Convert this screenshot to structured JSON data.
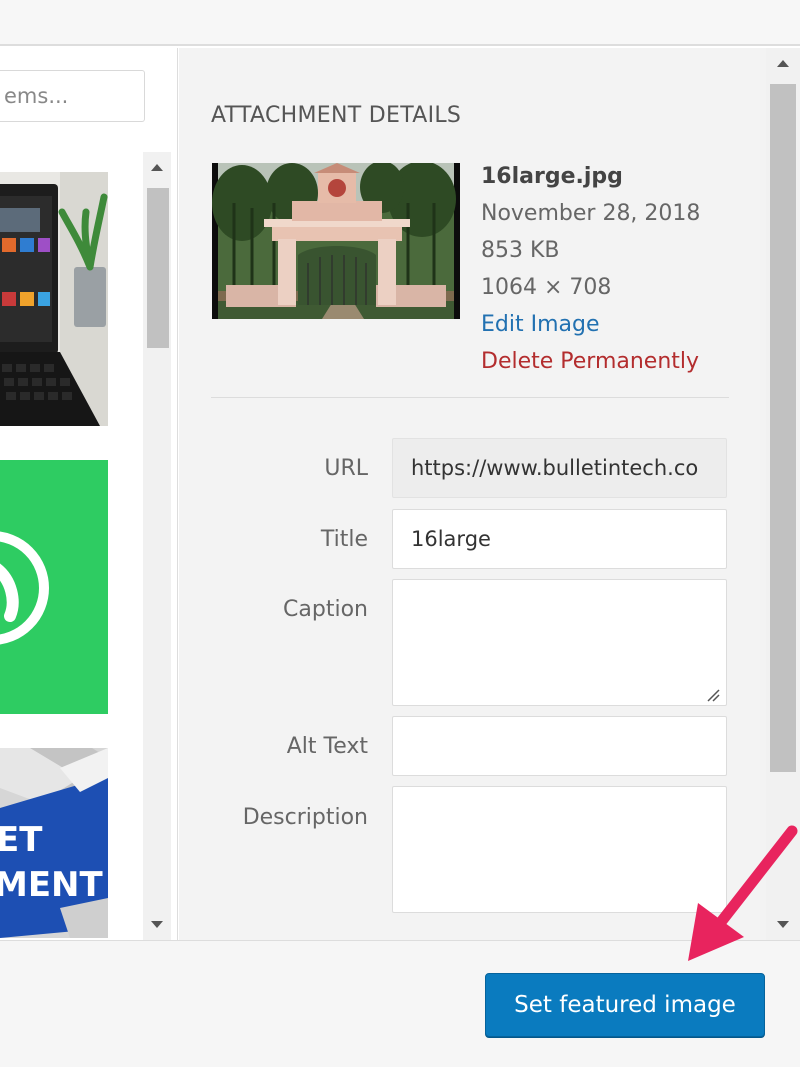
{
  "search": {
    "value": "ems..."
  },
  "details": {
    "heading": "ATTACHMENT DETAILS",
    "file": {
      "name": "16large.jpg",
      "date": "November 28, 2018",
      "size": "853 KB",
      "dimensions": "1064 × 708",
      "edit_label": "Edit Image",
      "delete_label": "Delete Permanently"
    },
    "fields": {
      "url_label": "URL",
      "url_value": "https://www.bulletintech.co",
      "title_label": "Title",
      "title_value": "16large",
      "caption_label": "Caption",
      "caption_value": "",
      "alt_label": "Alt Text",
      "alt_value": "",
      "description_label": "Description",
      "description_value": ""
    }
  },
  "thumbnails": {
    "items": [
      {
        "icon": "laptop-plant-thumbnail"
      },
      {
        "icon": "whatsapp-thumbnail"
      },
      {
        "icon": "keyboard-key-thumbnail",
        "text_1": "ET",
        "text_2": "MENT"
      }
    ]
  },
  "toolbar": {
    "primary_label": "Set featured image"
  },
  "colors": {
    "primary": "#0a7bbf",
    "link": "#2271b1",
    "danger": "#b32d2e",
    "annotation": "#e8245e"
  }
}
